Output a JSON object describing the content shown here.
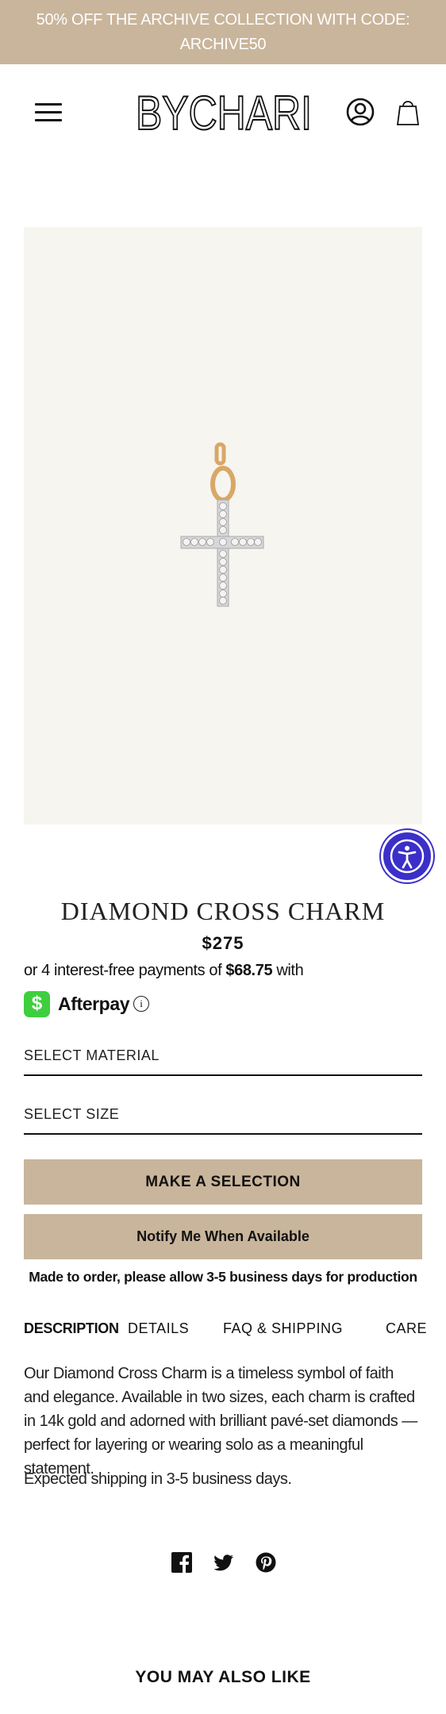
{
  "promo": {
    "text": "50% OFF THE ARCHIVE COLLECTION WITH CODE: ARCHIVE50"
  },
  "header": {
    "logo_text": "BYCHARI"
  },
  "product": {
    "title": "DIAMOND CROSS CHARM",
    "price": "$275",
    "installments_prefix": "or 4 interest-free payments of ",
    "installments_amount": "$68.75",
    "installments_suffix": " with",
    "afterpay_label": "Afterpay",
    "afterpay_badge": "$",
    "info_glyph": "i"
  },
  "options": {
    "material_label": "SELECT MATERIAL",
    "size_label": "SELECT SIZE"
  },
  "buttons": {
    "primary": "MAKE A SELECTION",
    "secondary": "Notify Me When Available"
  },
  "notice": "Made to order, please allow 3-5 business days for production",
  "tabs": [
    {
      "label": "DESCRIPTION",
      "active": true
    },
    {
      "label": "DETAILS",
      "active": false
    },
    {
      "label": "FAQ & SHIPPING",
      "active": false
    },
    {
      "label": "CARE",
      "active": false
    }
  ],
  "description": {
    "body": "Our Diamond Cross Charm is a timeless symbol of faith and elegance. Available in two sizes, each charm is crafted in 14k gold and adorned with brilliant pavé-set diamonds — perfect for layering or wearing solo as a meaningful statement.",
    "shipping": "Expected shipping in 3-5 business days."
  },
  "share": {
    "icons": [
      "facebook-icon",
      "twitter-icon",
      "pinterest-icon"
    ]
  },
  "related": {
    "heading": "YOU MAY ALSO LIKE"
  },
  "colors": {
    "accent": "#c9b59b",
    "image_bg": "#f6f5f0",
    "afterpay_green": "#3ecf3e",
    "a11y_purple": "#3b2fc9"
  }
}
